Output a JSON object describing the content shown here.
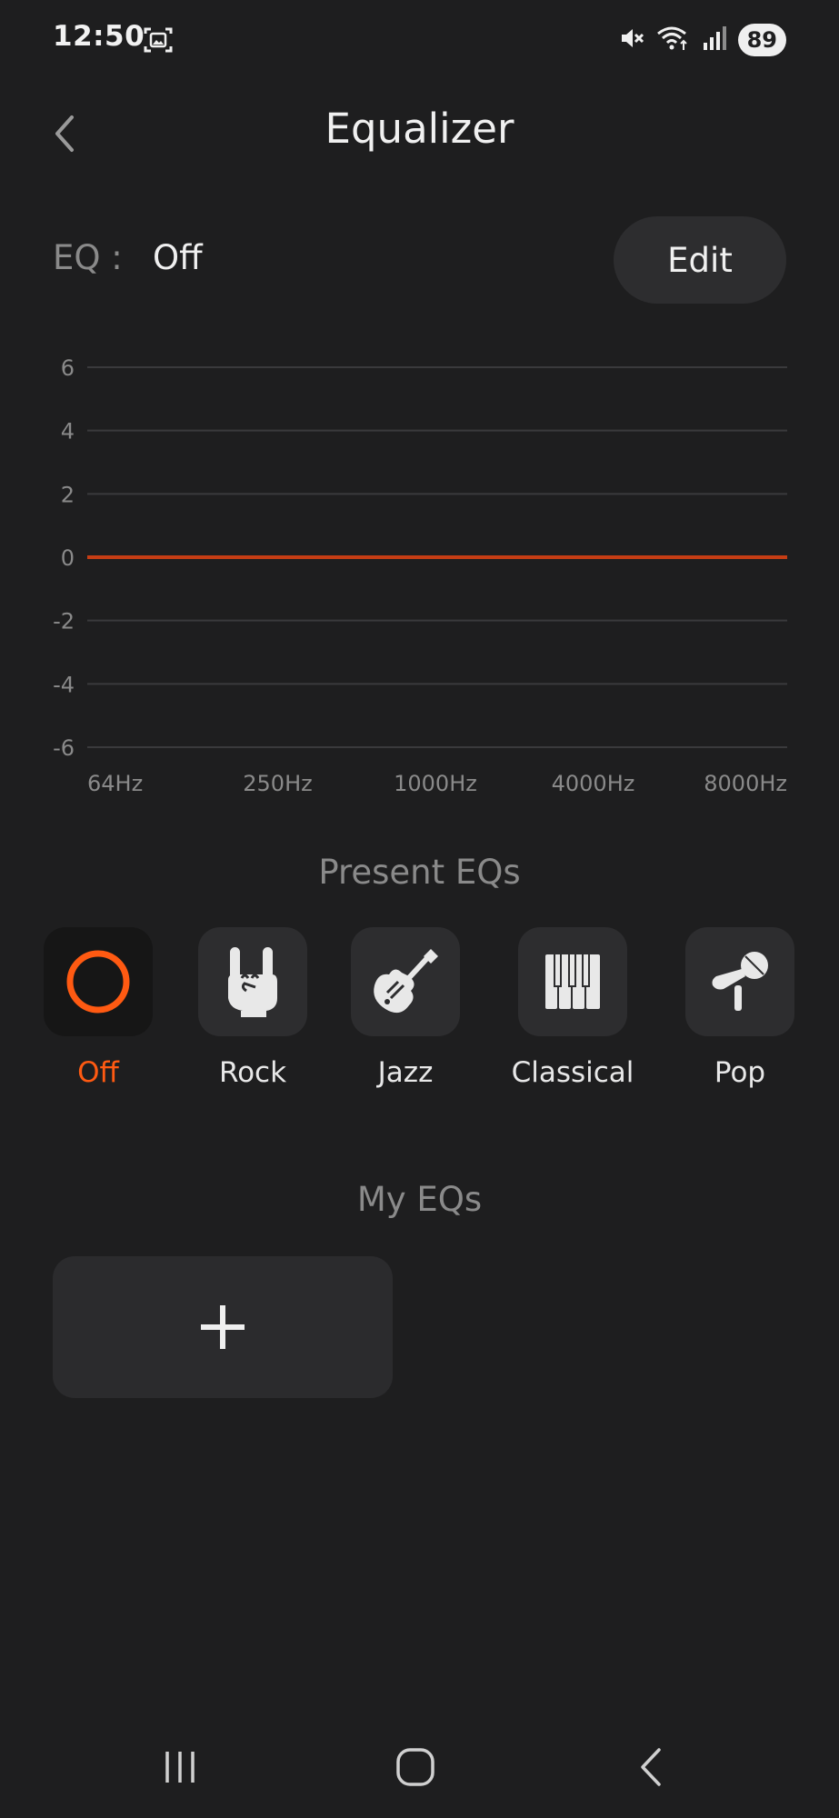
{
  "status_bar": {
    "time": "12:50",
    "battery": "89",
    "icons": [
      "screenshot-icon",
      "mute-icon",
      "wifi-icon",
      "signal-icon",
      "battery-icon"
    ]
  },
  "header": {
    "title": "Equalizer",
    "back_icon": "chevron-left-icon"
  },
  "eq": {
    "label": "EQ :",
    "value": "Off",
    "edit_label": "Edit"
  },
  "chart_data": {
    "type": "line",
    "x": [
      "64Hz",
      "250Hz",
      "1000Hz",
      "4000Hz",
      "8000Hz"
    ],
    "series": [
      {
        "values": [
          0,
          0,
          0,
          0,
          0
        ],
        "color": "#c63d14"
      }
    ],
    "yticks": [
      6,
      4,
      2,
      0,
      -2,
      -4,
      -6
    ],
    "ylim": [
      -6,
      6
    ],
    "grid": true,
    "xlabel": "",
    "ylabel": ""
  },
  "presets": {
    "title": "Present EQs",
    "items": [
      {
        "label": "Off",
        "icon": "off-ring-icon",
        "active": true
      },
      {
        "label": "Rock",
        "icon": "rock-hand-icon",
        "active": false
      },
      {
        "label": "Jazz",
        "icon": "guitar-icon",
        "active": false
      },
      {
        "label": "Classical",
        "icon": "piano-icon",
        "active": false
      },
      {
        "label": "Pop",
        "icon": "microphone-icon",
        "active": false
      }
    ]
  },
  "my_eqs": {
    "title": "My EQs",
    "add_icon": "plus-icon"
  },
  "nav_bar": {
    "icons": [
      "recent-apps-icon",
      "home-icon",
      "back-icon"
    ]
  },
  "colors": {
    "background": "#1e1e1f",
    "accent": "#ff5a12",
    "eq_line": "#c63d14",
    "tile": "#2d2d2f",
    "muted_text": "#8a8a8a"
  }
}
